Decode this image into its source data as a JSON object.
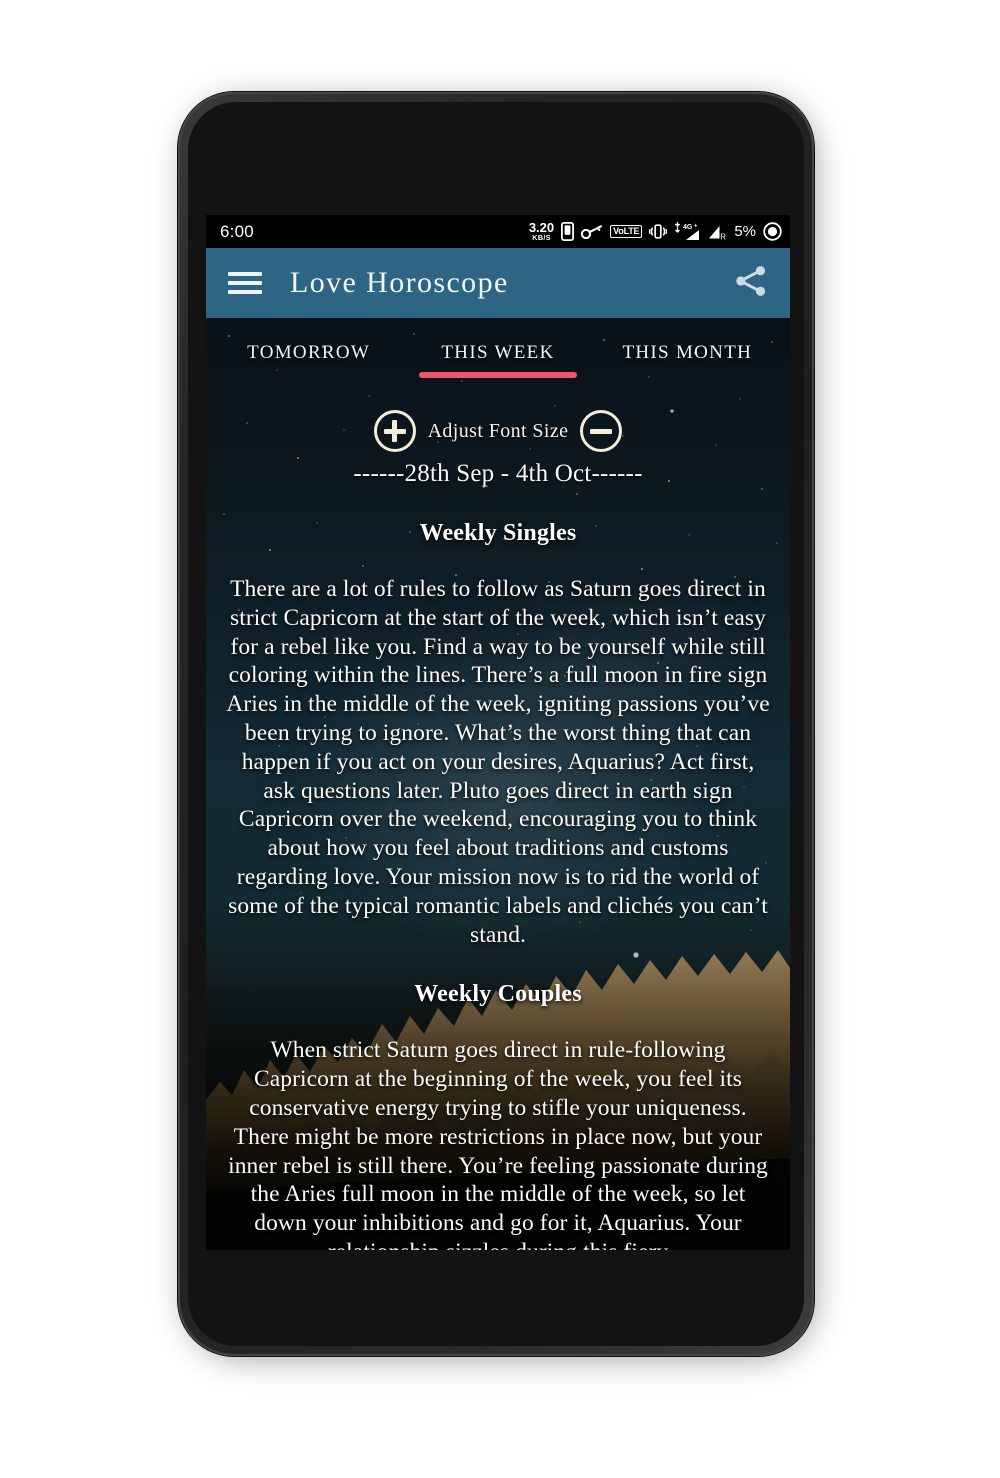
{
  "status_bar": {
    "time": "6:00",
    "net_speed_value": "3.20",
    "net_speed_unit": "KB/S",
    "volte_label": "VoLTE",
    "roaming_label": "R",
    "battery_percent": "5%",
    "icons": [
      "sim-card-icon",
      "vpn-key-icon",
      "volte-icon",
      "vibrate-icon",
      "signal-4g-plus-icon",
      "signal-roaming-icon",
      "battery-icon"
    ]
  },
  "app_bar": {
    "menu_icon": "hamburger-menu-icon",
    "title": "Love  Horoscope",
    "share_icon": "share-icon",
    "background_color": "#2e6585"
  },
  "tabs": {
    "active_index": 1,
    "indicator_color": "#f0566e",
    "items": [
      {
        "label": "TOMORROW"
      },
      {
        "label": "THIS WEEK"
      },
      {
        "label": "THIS MONTH"
      }
    ]
  },
  "font_size_control": {
    "increase_icon": "plus-circle-icon",
    "label": "Adjust Font Size",
    "decrease_icon": "minus-circle-icon"
  },
  "date_range": "------28th Sep - 4th Oct------",
  "sections": [
    {
      "title": "Weekly Singles",
      "body": "There are a lot of rules to follow as Saturn goes direct in strict Capricorn at the start of the week, which isn’t easy for a rebel like you. Find a way to be yourself while still coloring within the lines. There’s a full moon in fire sign Aries in the middle of the week, igniting passions you’ve been trying to ignore. What’s the worst thing that can happen if you act on your desires, Aquarius? Act first, ask questions later. Pluto goes direct in earth sign Capricorn over the weekend, encouraging you to think about how you feel about traditions and customs regarding love. Your mission now is to rid the world of some of the typical romantic labels and clichés you can’t stand."
    },
    {
      "title": "Weekly Couples",
      "body": "When strict Saturn goes direct in rule-following Capricorn at the beginning of the week, you feel its conservative energy trying to stifle your uniqueness. There might be more restrictions in place now, but your inner rebel is still there. You’re feeling passionate during the Aries full moon in the middle of the week, so let down your inhibitions and go for it, Aquarius. Your relationship sizzles during this fiery"
    }
  ],
  "colors": {
    "accent_pink": "#f0566e",
    "appbar_blue": "#2e6585",
    "sky_dark": "#0e1a21",
    "text_cream": "#f3eddc"
  }
}
